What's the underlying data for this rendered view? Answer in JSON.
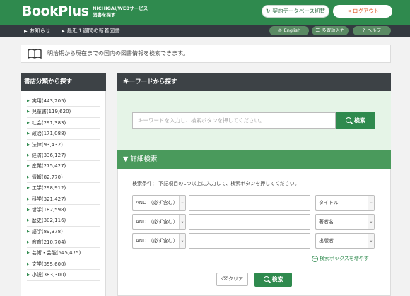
{
  "header": {
    "logo": "BookPlus",
    "logo_sub1": "NICHIGAI/WEBサービス",
    "logo_sub2": "図書を探す",
    "switch_label": "契約データベース切替",
    "logout_label": "ログアウト"
  },
  "nav": {
    "links": [
      "お知らせ",
      "最近１週間の新着図書"
    ],
    "english": "English",
    "bulk_input": "多置語入力",
    "help": "ヘルプ"
  },
  "info_text": "明治期から現在までの国内の図書情報を検索できます。",
  "sidebar": {
    "title": "書店分類から探す",
    "items": [
      "実用(443,205)",
      "児童書(119,620)",
      "社会(291,383)",
      "政治(171,088)",
      "法律(93,432)",
      "経済(336,127)",
      "産業(275,427)",
      "情報(82,770)",
      "工学(298,912)",
      "科学(321,427)",
      "哲学(182,598)",
      "歴史(302,116)",
      "語学(89,378)",
      "教育(210,704)",
      "芸術・芸能(545,475)",
      "文学(355,600)",
      "小説(383,300)"
    ]
  },
  "keyword": {
    "title": "キーワードから探す",
    "placeholder": "キーワードを入力し、検索ボタンを押してください。",
    "button": "検索"
  },
  "advanced": {
    "title": "▼ 詳細検索",
    "condition": "検索条件： 下記項目の1つ以上に入力して、検索ボタンを押してください。",
    "rows": [
      {
        "op": "AND （必ず含む）",
        "field": "タイトル"
      },
      {
        "op": "AND （必ず含む）",
        "field": "著者名"
      },
      {
        "op": "AND （必ず含む）",
        "field": "出版者"
      }
    ],
    "add_boxes": "検索ボックスを増やす",
    "clear": "クリア",
    "search": "検索"
  },
  "colors": {
    "brand_green": "#2f8a4e",
    "dark_header": "#3d4246",
    "logout_orange": "#e05a2a"
  }
}
